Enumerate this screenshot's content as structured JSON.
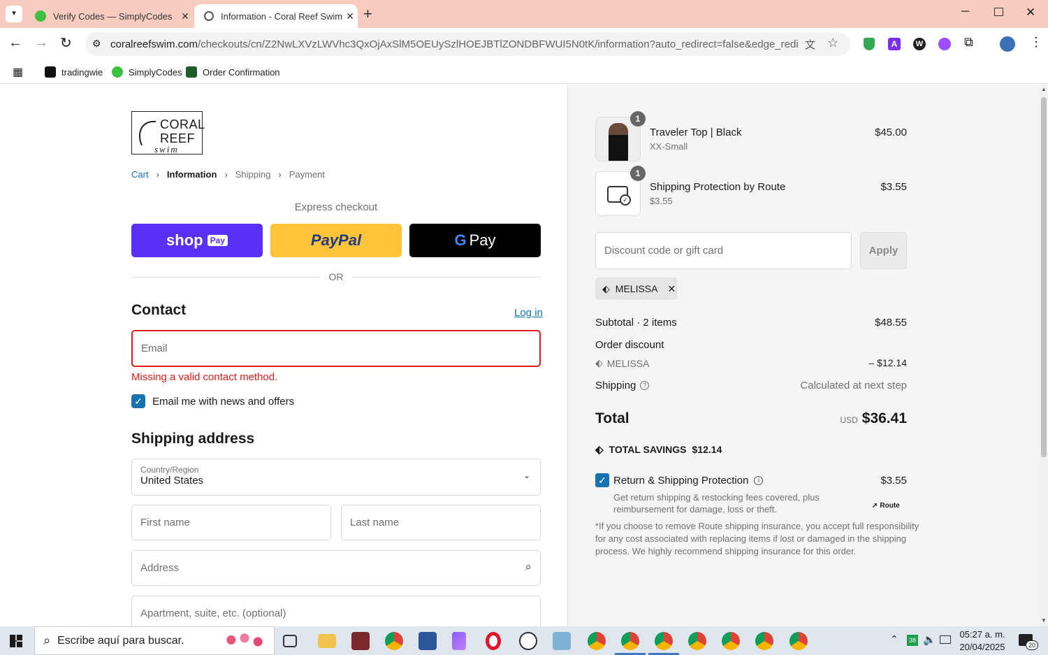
{
  "browser": {
    "tabs": [
      {
        "title": "Verify Codes — SimplyCodes",
        "active": false
      },
      {
        "title": "Information - Coral Reef Swim",
        "active": true
      }
    ],
    "url_host": "coralreefswim.com",
    "url_path": "/checkouts/cn/Z2NwLXVzLWVhc3QxOjAxSlM5OEUySzlHOEJBTlZONDBFWUI5N0tK/information?auto_redirect=false&edge_redirect=true&...",
    "bookmarks": [
      "tradingwie",
      "SimplyCodes",
      "Order Confirmation"
    ]
  },
  "checkout": {
    "logo_line1": "CORAL",
    "logo_line2": "REEF",
    "logo_script": "swim",
    "breadcrumb": [
      "Cart",
      "Information",
      "Shipping",
      "Payment"
    ],
    "express_label": "Express checkout",
    "shop_pay": "shop",
    "shop_pay_badge": "Pay",
    "paypal": "PayPal",
    "gpay": "Pay",
    "or": "OR",
    "contact_heading": "Contact",
    "login": "Log in",
    "email_placeholder": "Email",
    "email_error": "Missing a valid contact method.",
    "news_opt_in": "Email me with news and offers",
    "shipping_heading": "Shipping address",
    "country_label": "Country/Region",
    "country_value": "United States",
    "first_name": "First name",
    "last_name": "Last name",
    "address": "Address",
    "apartment": "Apartment, suite, etc. (optional)"
  },
  "summary": {
    "items": [
      {
        "qty": "1",
        "name": "Traveler Top | Black",
        "variant": "XX-Small",
        "price": "$45.00"
      },
      {
        "qty": "1",
        "name": "Shipping Protection by Route",
        "variant": "$3.55",
        "price": "$3.55"
      }
    ],
    "discount_placeholder": "Discount code or gift card",
    "apply": "Apply",
    "applied_code": "MELISSA",
    "subtotal_label": "Subtotal · 2 items",
    "subtotal_value": "$48.55",
    "order_discount_label": "Order discount",
    "discount_code": "MELISSA",
    "discount_value": "– $12.14",
    "shipping_label": "Shipping",
    "shipping_value": "Calculated at next step",
    "total_label": "Total",
    "currency": "USD",
    "total_value": "$36.41",
    "savings_label": "TOTAL SAVINGS",
    "savings_value": "$12.14",
    "route_label": "Return & Shipping Protection",
    "route_price": "$3.55",
    "route_desc1": "Get return shipping & restocking fees covered, plus",
    "route_desc2": "reimbursement for damage, loss or theft.",
    "route_brand": "Route",
    "route_note1": "*If you choose to remove Route shipping insurance, you accept full responsibility",
    "route_note2": "for any cost associated with replacing items if lost or damaged in the shipping",
    "route_note3": "process. We highly recommend shipping insurance for this order."
  },
  "taskbar": {
    "search_placeholder": "Escribe aquí para buscar.",
    "time": "05:27 a. m.",
    "date": "20/04/2025",
    "notif_count": "20",
    "badge": "38"
  },
  "colors": {
    "tab_bar": "#f8cdbf",
    "accent_blue": "#1773b0",
    "error_red": "#dd1d1d",
    "shop_pay": "#5a31f4",
    "paypal": "#ffc439"
  }
}
